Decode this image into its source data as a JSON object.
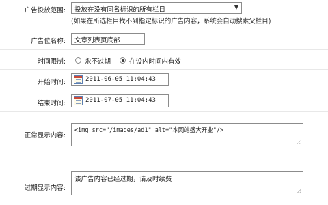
{
  "fields": {
    "scope": {
      "label": "广告投放范围:",
      "selected": "投放在没有同名标识的所有栏目",
      "hint": "(如果在所选栏目找不到指定标识的广告内容，系统会自动搜索父栏目)"
    },
    "position_name": {
      "label": "广告位名称:",
      "value": "文章列表页底部"
    },
    "time_limit": {
      "label": "时间限制:",
      "options": [
        {
          "label": "永不过期",
          "selected": false
        },
        {
          "label": "在设内时间内有效",
          "selected": true
        }
      ]
    },
    "start_time": {
      "label": "开始时间:",
      "value": "2011-06-05 11:04:43"
    },
    "end_time": {
      "label": "结束时间:",
      "value": "2011-07-05 11:04:43"
    },
    "normal_content": {
      "label": "正常显示内容:",
      "value": "<img src=\"/images/ad1\" alt=\"本网站盛大开业\"/>"
    },
    "expired_content": {
      "label": "过期显示内容:",
      "value": "该广告内容已经过期，请及时续费"
    }
  },
  "icons": {
    "dropdown": "triangle-down-icon",
    "calendar": "calendar-icon",
    "resize": "resize-grip-icon"
  }
}
